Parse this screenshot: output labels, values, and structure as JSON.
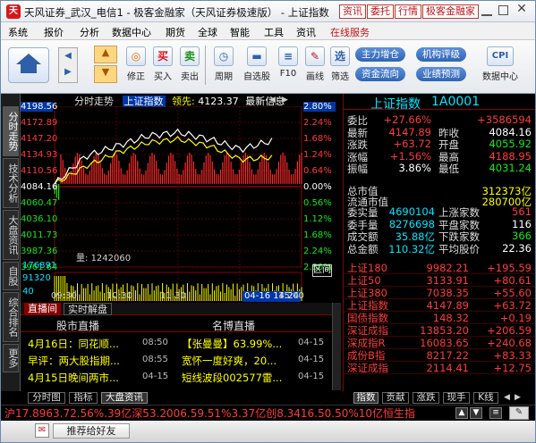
{
  "window": {
    "title": "天风证券_武汉_电信1 - 极客金融家（天风证券极速版） - 上证指数",
    "buttons": [
      "资讯",
      "委托",
      "行情",
      "极客金融家"
    ]
  },
  "menu": [
    "系统",
    "报价",
    "分析",
    "数据中心",
    "期货",
    "全球",
    "智能",
    "工具",
    "资讯",
    "在线服务"
  ],
  "toolbar": {
    "tools": [
      {
        "label": "修正",
        "icon": "refresh-icon"
      },
      {
        "label": "买入",
        "icon": "buy-icon",
        "glyph": "买"
      },
      {
        "label": "卖出",
        "icon": "sell-icon",
        "glyph": "卖"
      },
      {
        "label": "周期",
        "icon": "period-icon"
      },
      {
        "label": "自选股",
        "icon": "folder-icon"
      },
      {
        "label": "F10",
        "icon": "f10-icon"
      },
      {
        "label": "画线",
        "icon": "pen-icon"
      },
      {
        "label": "筛选",
        "icon": "filter-icon",
        "glyph": "选"
      },
      {
        "label": "数据中心",
        "icon": "cpi-icon",
        "glyph": "CPI"
      }
    ],
    "pills": [
      "主力增仓",
      "机构评级",
      "资金流向",
      "业绩预测"
    ]
  },
  "side_tabs": [
    "分时走势",
    "技术分析",
    "大盘资讯",
    "自股",
    "综合排名",
    "更多"
  ],
  "chart": {
    "tab": "分时走势",
    "index_name": "上证指数",
    "lead_label": "领先:",
    "lead_value": "4123.37",
    "latest_label": "最新信息",
    "volume_label": "量:",
    "volume_value": "1242060",
    "section_button": "区间",
    "date_badge": "04-16 14:24",
    "y_left": [
      "4198.56",
      "4172.89",
      "4147.20",
      "4134.93",
      "4110.56",
      "4084.16",
      "4060.47",
      "4036.10",
      "4011.73",
      "3987.36",
      "3961.64"
    ],
    "y_right": [
      "2.80%",
      "2.24%",
      "1.68%",
      "1.24%",
      "0.64%",
      "0.00%",
      "0.56%",
      "1.12%",
      "1.68%",
      "2.24%",
      "2.80%"
    ],
    "vol_ticks": [
      "176891",
      "91320",
      "40"
    ],
    "x_labels": [
      "09:30",
      "10:30",
      "11:30",
      "14:00",
      "15:00"
    ]
  },
  "chart_data": {
    "type": "line",
    "title": "上证指数",
    "x": [
      "09:30",
      "10:00",
      "10:30",
      "11:00",
      "11:30",
      "13:30",
      "14:00",
      "14:24"
    ],
    "series": [
      {
        "name": "上证指数",
        "values": [
          4084.16,
          4125.0,
          4140.0,
          4155.0,
          4160.0,
          4150.0,
          4135.0,
          4147.89
        ]
      },
      {
        "name": "领先",
        "values": [
          4084.16,
          4110.0,
          4130.0,
          4145.0,
          4150.0,
          4140.0,
          4120.0,
          4123.37
        ]
      }
    ],
    "ylim": [
      3961.64,
      4198.56
    ],
    "colors": {
      "index": "#ffffff",
      "lead": "#ffff00",
      "up": "#ff2a2a",
      "down": "#17e617"
    }
  },
  "quote": {
    "title": "上证指数",
    "code": "1A0001",
    "rows_a": [
      {
        "l": "委比",
        "v": "+27.66%",
        "l2": "",
        "v2": "+3586594",
        "c": "#ff3b3b",
        "c2": "#ff3b3b"
      },
      {
        "l": "最新",
        "v": "4147.89",
        "l2": "昨收",
        "v2": "4084.16",
        "c": "#ff3b3b",
        "c2": "#ffffff"
      },
      {
        "l": "涨跌",
        "v": "+63.72",
        "l2": "开盘",
        "v2": "4055.92",
        "c": "#ff3b3b",
        "c2": "#19e619"
      },
      {
        "l": "涨幅",
        "v": "+1.56%",
        "l2": "最高",
        "v2": "4188.95",
        "c": "#ff3b3b",
        "c2": "#ff3b3b"
      },
      {
        "l": "振幅",
        "v": "3.86%",
        "l2": "最低",
        "v2": "4031.24",
        "c": "#ffffff",
        "c2": "#19e619"
      }
    ],
    "rows_b": [
      {
        "l": "总市值",
        "v": "312373亿",
        "c": "#ffff00"
      },
      {
        "l": "流通市值",
        "v": "280700亿",
        "c": "#ffff00"
      }
    ],
    "rows_c": [
      {
        "l": "委实量",
        "v": "4690104",
        "l2": "上涨家数",
        "v2": "561",
        "c": "#00e5ff",
        "c2": "#ff3b3b"
      },
      {
        "l": "委手量",
        "v": "8276698",
        "l2": "平盘家数",
        "v2": "116",
        "c": "#00e5ff",
        "c2": "#ffffff"
      },
      {
        "l": "成交额",
        "v": "35.88亿",
        "l2": "下跌家数",
        "v2": "366",
        "c": "#00e5ff",
        "c2": "#19e619"
      },
      {
        "l": "总金额",
        "v": "110.32亿",
        "l2": "平均股价",
        "v2": "22.36",
        "c": "#00e5ff",
        "c2": "#ffffff"
      }
    ],
    "indices": [
      {
        "n": "上证180",
        "p": "9982.21",
        "d": "+195.59",
        "c": "#ff3b3b"
      },
      {
        "n": "上证50",
        "p": "3133.91",
        "d": "+80.61",
        "c": "#ff3b3b"
      },
      {
        "n": "上证380",
        "p": "7038.35",
        "d": "+55.60",
        "c": "#ff3b3b"
      },
      {
        "n": "上证指数",
        "p": "4147.89",
        "d": "+63.72",
        "c": "#ff3b3b"
      },
      {
        "n": "国债指数",
        "p": "148.32",
        "d": "+0.19",
        "c": "#ff3b3b"
      },
      {
        "n": "深证成指",
        "p": "13853.20",
        "d": "+206.59",
        "c": "#ff3b3b"
      },
      {
        "n": "深成指R",
        "p": "16083.65",
        "d": "+240.68",
        "c": "#ff3b3b"
      },
      {
        "n": "成份B指",
        "p": "8217.22",
        "d": "+83.33",
        "c": "#ff3b3b"
      },
      {
        "n": "深证成指",
        "p": "2114.41",
        "d": "+12.75",
        "c": "#ff3b3b"
      }
    ],
    "tabs": [
      "指数",
      "贡献",
      "涨跌",
      "现手",
      "K线"
    ]
  },
  "news": {
    "tabs": [
      "直播间",
      "实时解盘"
    ],
    "col1": "股市直播",
    "col2": "名博直播",
    "left": [
      {
        "t": "4月16日：同花顺...",
        "time": "08:50"
      },
      {
        "t": "早评：两大股指期...",
        "time": "08:55"
      },
      {
        "t": "4月15日晚间两市...",
        "time": "04-15"
      }
    ],
    "right": [
      {
        "t": "【张曼曼】63.99%...",
        "date": "04-15"
      },
      {
        "t": "宽怀一度好爽，20...",
        "date": "04-15"
      },
      {
        "t": "短线波段002577雷...",
        "date": "04-15"
      }
    ]
  },
  "bottom_tabs": [
    "分时图",
    "指标",
    "大盘资讯"
  ],
  "status": "沪17.8963.72.56%.39亿深53.2006.59.51%3.37亿创8.3416.50.50%10亿恒生指",
  "promo": "推荐给好友"
}
